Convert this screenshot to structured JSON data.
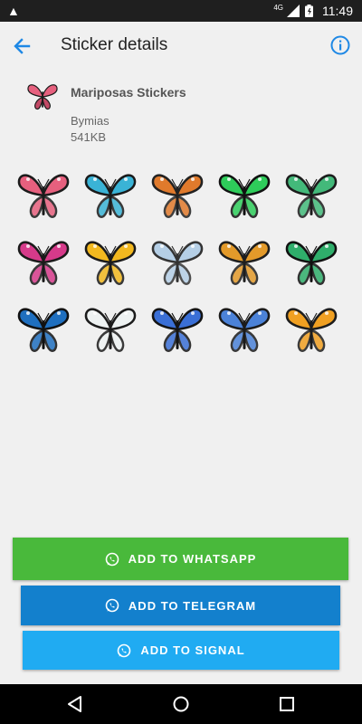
{
  "status_bar": {
    "time": "11:49",
    "network": "4G"
  },
  "app_bar": {
    "title": "Sticker details",
    "back_icon": "arrow-back-icon",
    "info_icon": "info-icon"
  },
  "pack": {
    "name": "Mariposas Stickers",
    "publisher": "Bymias",
    "size": "541KB"
  },
  "stickers": [
    {
      "colors": [
        "#e6607e",
        "#1b1b1b"
      ]
    },
    {
      "colors": [
        "#3ab3d6",
        "#1a1a1a"
      ]
    },
    {
      "colors": [
        "#e07a2c",
        "#222222"
      ]
    },
    {
      "colors": [
        "#2ecc5a",
        "#111111"
      ]
    },
    {
      "colors": [
        "#43b97a",
        "#1c1c1c"
      ]
    },
    {
      "colors": [
        "#d63a8a",
        "#1a1a1a"
      ]
    },
    {
      "colors": [
        "#f2b81f",
        "#1a1a1a"
      ]
    },
    {
      "colors": [
        "#b5cfe6",
        "#333333"
      ]
    },
    {
      "colors": [
        "#e39a2a",
        "#1e1e1e"
      ]
    },
    {
      "colors": [
        "#2fae6b",
        "#111111"
      ]
    },
    {
      "colors": [
        "#1f6fbf",
        "#111111"
      ]
    },
    {
      "colors": [
        "#eef2f2",
        "#1b1b1b"
      ]
    },
    {
      "colors": [
        "#3a6fd6",
        "#141414"
      ]
    },
    {
      "colors": [
        "#4b82d8",
        "#1a1a1a"
      ]
    },
    {
      "colors": [
        "#f0a022",
        "#1d1d1d"
      ]
    }
  ],
  "buttons": {
    "whatsapp": "ADD TO WHATSAPP",
    "telegram": "ADD TO TELEGRAM",
    "signal": "ADD TO SIGNAL"
  },
  "colors": {
    "whatsapp": "#49b93b",
    "telegram": "#1380cd",
    "signal": "#20abf2",
    "accent": "#1e88e5"
  }
}
